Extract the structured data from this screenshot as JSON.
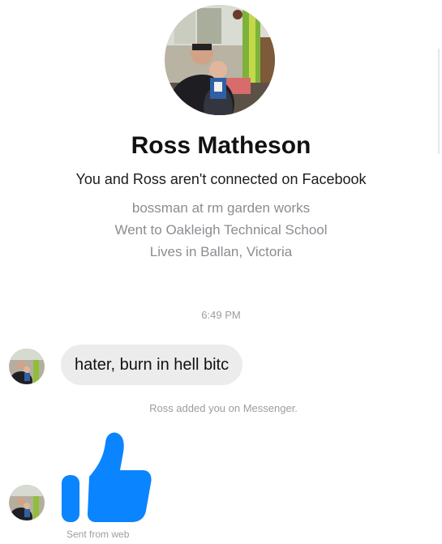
{
  "profile": {
    "name": "Ross Matheson",
    "connection_status": "You and Ross aren't connected on Facebook",
    "details": [
      "bossman at rm garden works",
      "Went to Oakleigh Technical School",
      "Lives in Ballan, Victoria"
    ]
  },
  "conversation": {
    "timestamp": "6:49 PM",
    "message_text": "hater,  burn in hell bitc",
    "system_note": "Ross added you on Messenger.",
    "like_icon": "thumbs-up-icon",
    "sent_from": "Sent from web"
  },
  "colors": {
    "like_blue": "#0a84ff",
    "bubble_gray": "#ececec",
    "meta_gray": "#8a8d91"
  }
}
